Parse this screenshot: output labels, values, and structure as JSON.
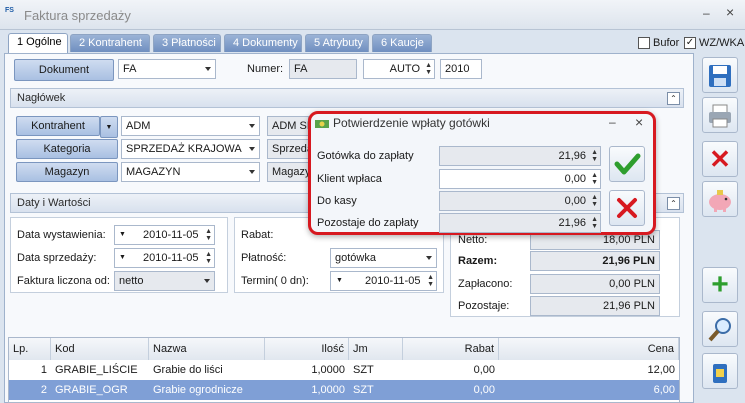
{
  "window": {
    "title": "Faktura sprzedaży",
    "icon_text": "FS",
    "minimize": "–",
    "close": "×"
  },
  "tabs": [
    {
      "label": "1 Ogólne",
      "active": true
    },
    {
      "label": "2 Kontrahent"
    },
    {
      "label": "3 Płatności"
    },
    {
      "label": "4 Dokumenty"
    },
    {
      "label": "5 Atrybuty"
    },
    {
      "label": "6 Kaucje"
    }
  ],
  "toolbar_checks": {
    "bufor_label": "Bufor",
    "bufor_checked": "",
    "wzwka_label": "WZ/WKA",
    "wzwka_checked": "✓"
  },
  "document": {
    "button": "Dokument",
    "type": "FA",
    "numer_label": "Numer:",
    "numer_prefix": "FA",
    "numer_mode": "AUTO",
    "numer_year": "2010"
  },
  "naglowek": {
    "title": "Nagłówek",
    "kontrahent_button": "Kontrahent",
    "kontrahent_value": "ADM",
    "kontrahent_name": "ADM SP",
    "kategoria_button": "Kategoria",
    "kategoria_value": "SPRZEDAŻ KRAJOWA",
    "kategoria_desc": "Sprzeda",
    "magazyn_button": "Magazyn",
    "magazyn_value": "MAGAZYN",
    "magazyn_desc": "Magazy"
  },
  "daty": {
    "title": "Daty i Wartości",
    "wystawienia_label": "Data wystawienia:",
    "wystawienia": "2010-11-05",
    "sprzedazy_label": "Data sprzedaży:",
    "sprzedazy": "2010-11-05",
    "liczona_label": "Faktura liczona od:",
    "liczona": "netto",
    "rabat_label": "Rabat:",
    "platnosc_label": "Płatność:",
    "platnosc": "gotówka",
    "termin_label": "Termin(    0 dn):",
    "termin": "2010-11-05"
  },
  "totals": {
    "netto_label": "Netto:",
    "netto": "18,00 PLN",
    "razem_label": "Razem:",
    "razem": "21,96 PLN",
    "zaplacono_label": "Zapłacono:",
    "zaplacono": "0,00 PLN",
    "pozostaje_label": "Pozostaje:",
    "pozostaje": "21,96 PLN"
  },
  "table": {
    "headers": [
      "Lp.",
      "Kod",
      "Nazwa",
      "Ilość",
      "Jm",
      "Rabat",
      "Cena"
    ],
    "rows": [
      {
        "lp": "1",
        "kod": "GRABIE_LIŚCIE",
        "nazwa": "Grabie do liści",
        "ilosc": "1,0000",
        "jm": "SZT",
        "rabat": "0,00",
        "cena": "12,00"
      },
      {
        "lp": "2",
        "kod": "GRABIE_OGR",
        "nazwa": "Grabie ogrodnicze",
        "ilosc": "1,0000",
        "jm": "SZT",
        "rabat": "0,00",
        "cena": "6,00"
      }
    ]
  },
  "dialog": {
    "title": "Potwierdzenie wpłaty gotówki",
    "minimize": "–",
    "close": "×",
    "gotowka_label": "Gotówka do zapłaty",
    "gotowka": "21,96",
    "klient_label": "Klient wpłaca",
    "klient": "0,00",
    "kasa_label": "Do kasy",
    "kasa": "0,00",
    "pozostaje_label": "Pozostaje do zapłaty",
    "pozostaje": "21,96"
  },
  "sidebar_icons": [
    "save-icon",
    "print-icon",
    "delete-icon",
    "piggy-bank-icon",
    "add-icon",
    "search-icon",
    "bin-icon"
  ],
  "colors": {
    "accent": "#1d5ba6",
    "confirm": "#2e9e2e",
    "cancel": "#d71920",
    "selected_row": "#7f9fd6"
  }
}
